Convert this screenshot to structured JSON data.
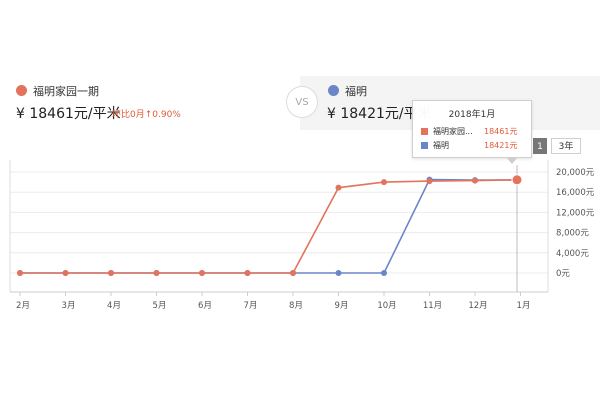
{
  "compare": {
    "left": {
      "name": "福明家园一期",
      "price": "¥ 18461元/平米",
      "change": "环比0月↑0.90%",
      "color": "#e3735d"
    },
    "vs_label": "VS",
    "right": {
      "name": "福明",
      "price": "¥ 18421元/平米",
      "color": "#6a86c6"
    }
  },
  "year_tabs": [
    {
      "label": "1年",
      "active": true
    },
    {
      "label": "3年",
      "active": false
    }
  ],
  "tooltip": {
    "title": "2018年1月",
    "rows": [
      {
        "label": "福明家园...",
        "value": "18461元",
        "color": "#e3735d"
      },
      {
        "label": "福明",
        "value": "18421元",
        "color": "#6a86c6"
      }
    ]
  },
  "chart_data": {
    "type": "line",
    "categories": [
      "2月",
      "3月",
      "4月",
      "5月",
      "6月",
      "7月",
      "8月",
      "9月",
      "10月",
      "11月",
      "12月",
      "1月"
    ],
    "series": [
      {
        "name": "福明家园一期",
        "color": "#e3735d",
        "values": [
          0,
          0,
          0,
          0,
          0,
          0,
          0,
          16900,
          18000,
          18200,
          18300,
          18461
        ]
      },
      {
        "name": "福明",
        "color": "#6a86c6",
        "values": [
          0,
          0,
          0,
          0,
          0,
          0,
          0,
          0,
          0,
          18500,
          18400,
          18421
        ]
      }
    ],
    "yticks": [
      "0元",
      "4,000元",
      "8,000元",
      "12,000元",
      "16,000元",
      "20,000元"
    ],
    "ylim": [
      0,
      20000
    ],
    "grid": true,
    "highlight_index": 11
  }
}
